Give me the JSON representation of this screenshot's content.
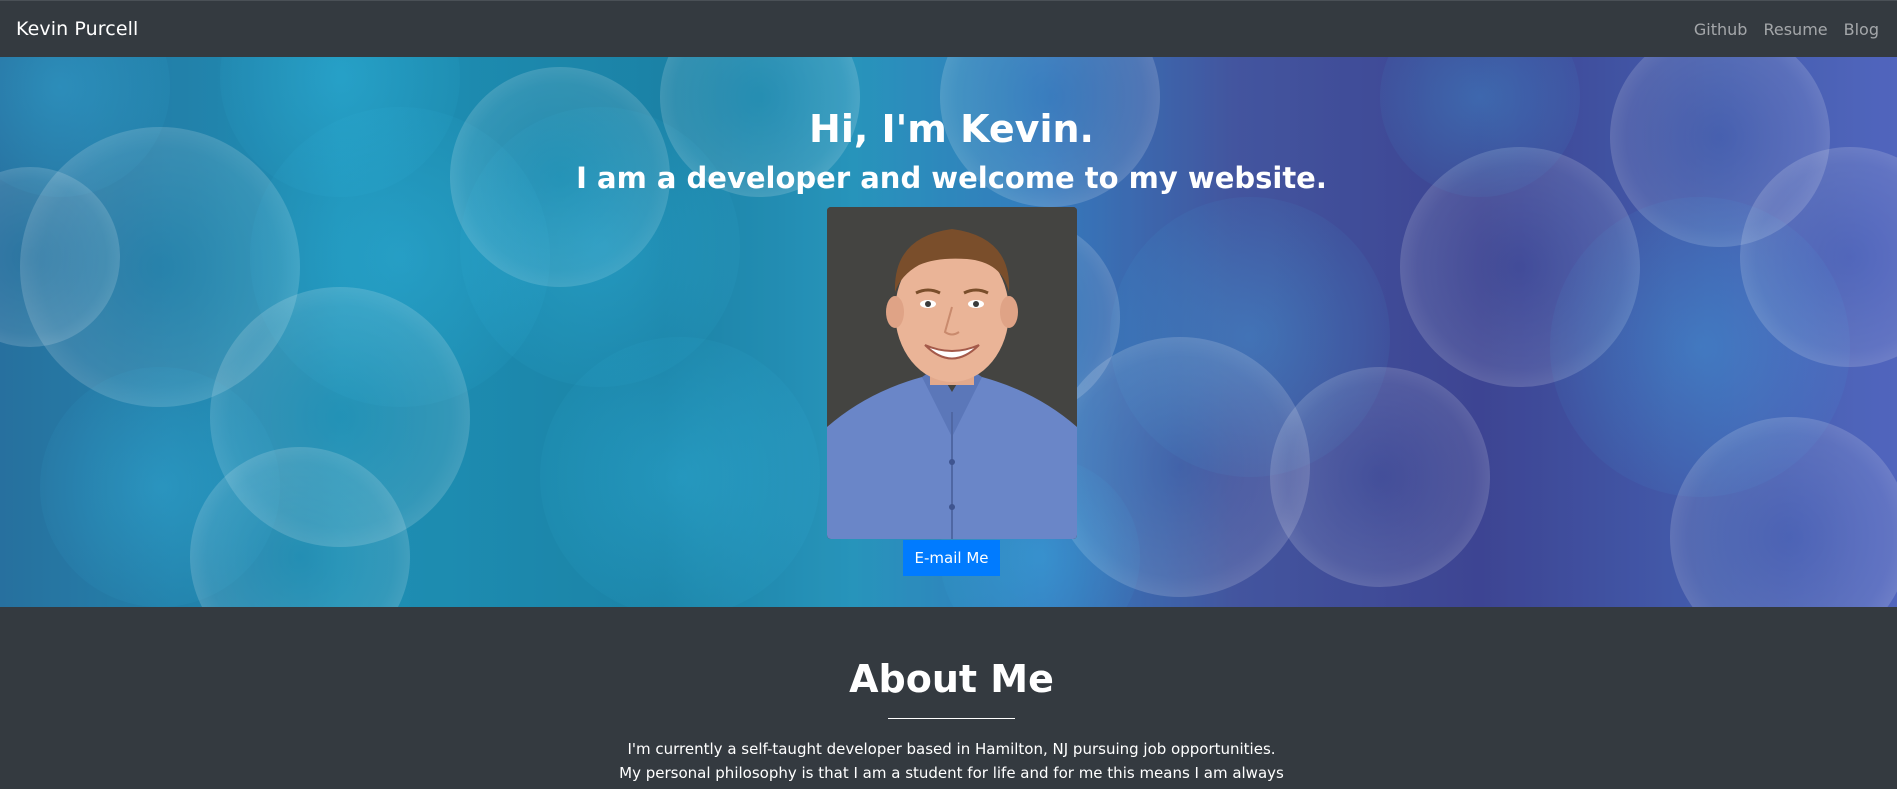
{
  "nav": {
    "brand": "Kevin Purcell",
    "links": [
      "Github",
      "Resume",
      "Blog"
    ]
  },
  "hero": {
    "title": "Hi, I'm Kevin.",
    "subtitle": "I am a developer and welcome to my website.",
    "email_button": "E-mail Me"
  },
  "about": {
    "title": "About Me",
    "lines": [
      "I'm currently a self-taught developer based in Hamilton, NJ pursuing job opportunities.",
      "My personal philosophy is that I am a student for life and for me this means I am always"
    ]
  },
  "colors": {
    "navbar_bg": "#343a40",
    "button_bg": "#007bff"
  }
}
